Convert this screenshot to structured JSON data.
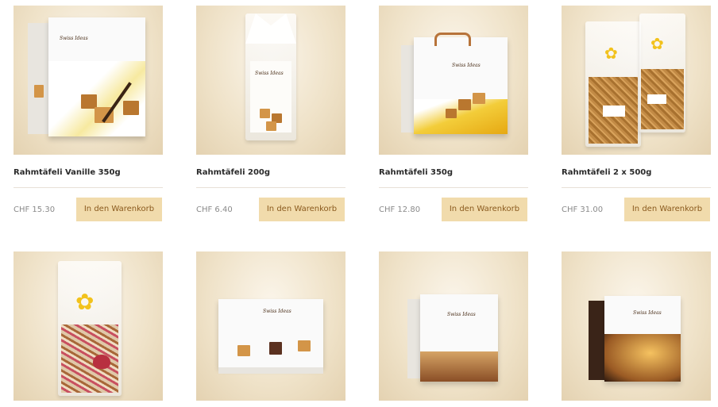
{
  "products": [
    {
      "title": "Rahmtäfeli Vanille 350g",
      "price": "CHF 15.30",
      "cart_label": "In den Warenkorb"
    },
    {
      "title": "Rahmtäfeli 200g",
      "price": "CHF 6.40",
      "cart_label": "In den Warenkorb"
    },
    {
      "title": "Rahmtäfeli 350g",
      "price": "CHF 12.80",
      "cart_label": "In den Warenkorb"
    },
    {
      "title": "Rahmtäfeli 2 x 500g",
      "price": "CHF 31.00",
      "cart_label": "In den Warenkorb"
    },
    {
      "title": "",
      "price": "",
      "cart_label": ""
    },
    {
      "title": "",
      "price": "",
      "cart_label": ""
    },
    {
      "title": "",
      "price": "",
      "cart_label": ""
    },
    {
      "title": "",
      "price": "",
      "cart_label": ""
    }
  ],
  "brand_logo_text": "Swiss Ideas",
  "colors": {
    "cart_button_bg": "#f1dbac",
    "cart_button_text": "#8a5a1e",
    "image_bg": "#efe2c8"
  }
}
